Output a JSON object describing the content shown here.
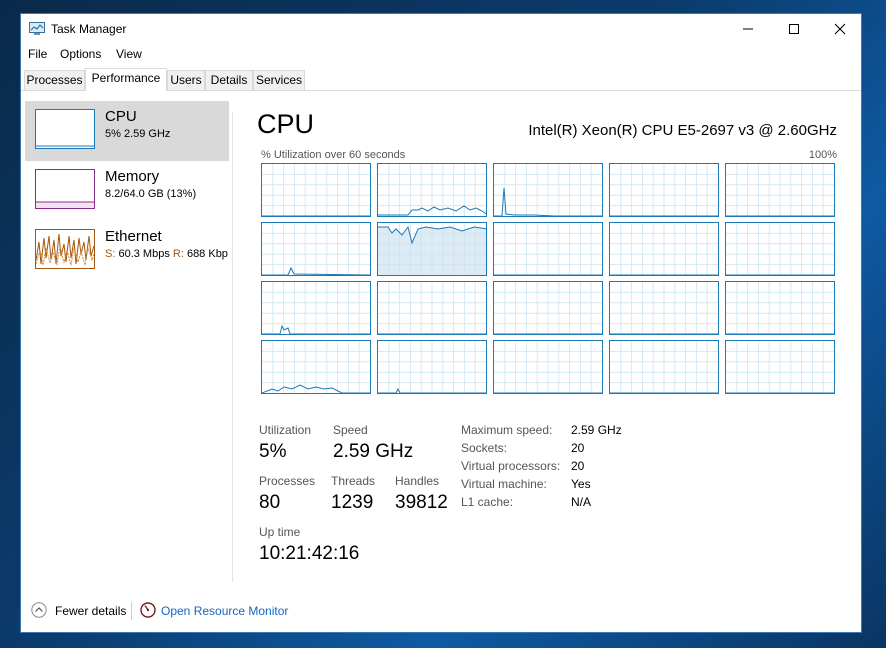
{
  "window": {
    "title": "Task Manager",
    "controls": {
      "minimize": "—",
      "maximize": "☐",
      "close": "✕"
    }
  },
  "menu": [
    "File",
    "Options",
    "View"
  ],
  "tabs": [
    "Processes",
    "Performance",
    "Users",
    "Details",
    "Services"
  ],
  "active_tab": "Performance",
  "sidebar": {
    "items": [
      {
        "name": "CPU",
        "detail": "5%  2.59 GHz",
        "color": "#1a7ab8",
        "selected": true
      },
      {
        "name": "Memory",
        "detail": "8.2/64.0 GB (13%)",
        "color": "#8b2b8b",
        "selected": false
      },
      {
        "name": "Ethernet",
        "detail_send_label": "S:",
        "detail_send": " 60.3 Mbps ",
        "detail_recv_label": "R:",
        "detail_recv": " 688 Kbp",
        "color": "#a7550a",
        "selected": false
      }
    ]
  },
  "main": {
    "heading": "CPU",
    "cpu_model": "Intel(R) Xeon(R) CPU E5-2697 v3 @ 2.60GHz",
    "graph_caption": "% Utilization over 60 seconds",
    "graph_max": "100%",
    "graph_count": 20,
    "stats": {
      "utilization_label": "Utilization",
      "utilization": "5%",
      "speed_label": "Speed",
      "speed": "2.59 GHz",
      "processes_label": "Processes",
      "processes": "80",
      "threads_label": "Threads",
      "threads": "1239",
      "handles_label": "Handles",
      "handles": "39812",
      "uptime_label": "Up time",
      "uptime": "10:21:42:16"
    },
    "details": [
      {
        "label": "Maximum speed:",
        "value": "2.59 GHz"
      },
      {
        "label": "Sockets:",
        "value": "20"
      },
      {
        "label": "Virtual processors:",
        "value": "20"
      },
      {
        "label": "Virtual machine:",
        "value": "Yes"
      },
      {
        "label": "L1 cache:",
        "value": "N/A"
      }
    ]
  },
  "footer": {
    "fewer_details": "Fewer details",
    "resource_monitor": "Open Resource Monitor"
  },
  "colors": {
    "accent": "#1a7ab8",
    "grid": "#d4e8f4",
    "link": "#1565c0"
  },
  "icons": [
    "task-manager-icon",
    "minimize-icon",
    "maximize-icon",
    "close-icon",
    "chevron-up-icon",
    "resource-monitor-icon"
  ]
}
